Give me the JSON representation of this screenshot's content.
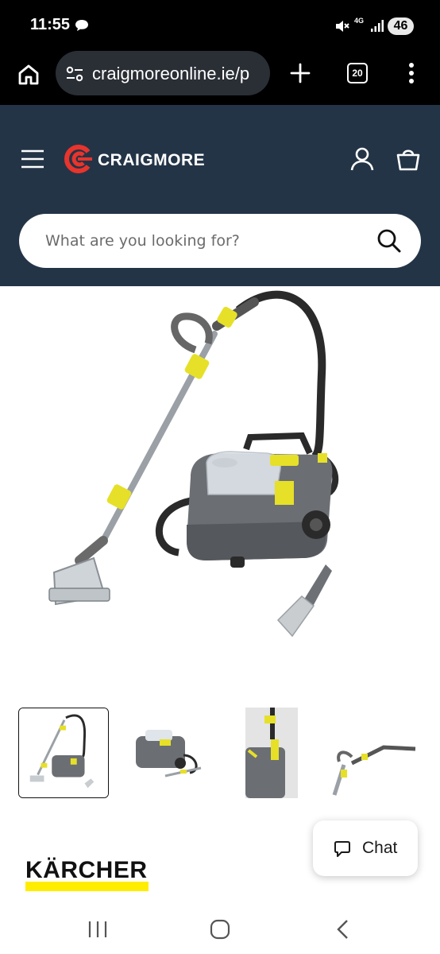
{
  "status_bar": {
    "time": "11:55",
    "network": "4G",
    "battery": "46"
  },
  "browser": {
    "url": "craigmoreonline.ie/p",
    "tab_count": "20"
  },
  "header": {
    "brand_name": "CRAIGMORE",
    "brand_color": "#e8342c",
    "background_color": "#243447",
    "search_placeholder": "What are you looking for?"
  },
  "product": {
    "thumbnail_count": 4,
    "active_thumbnail": 1,
    "manufacturer_logo_text": "KÄRCHER",
    "manufacturer_color": "#ffed00"
  },
  "chat": {
    "label": "Chat"
  }
}
